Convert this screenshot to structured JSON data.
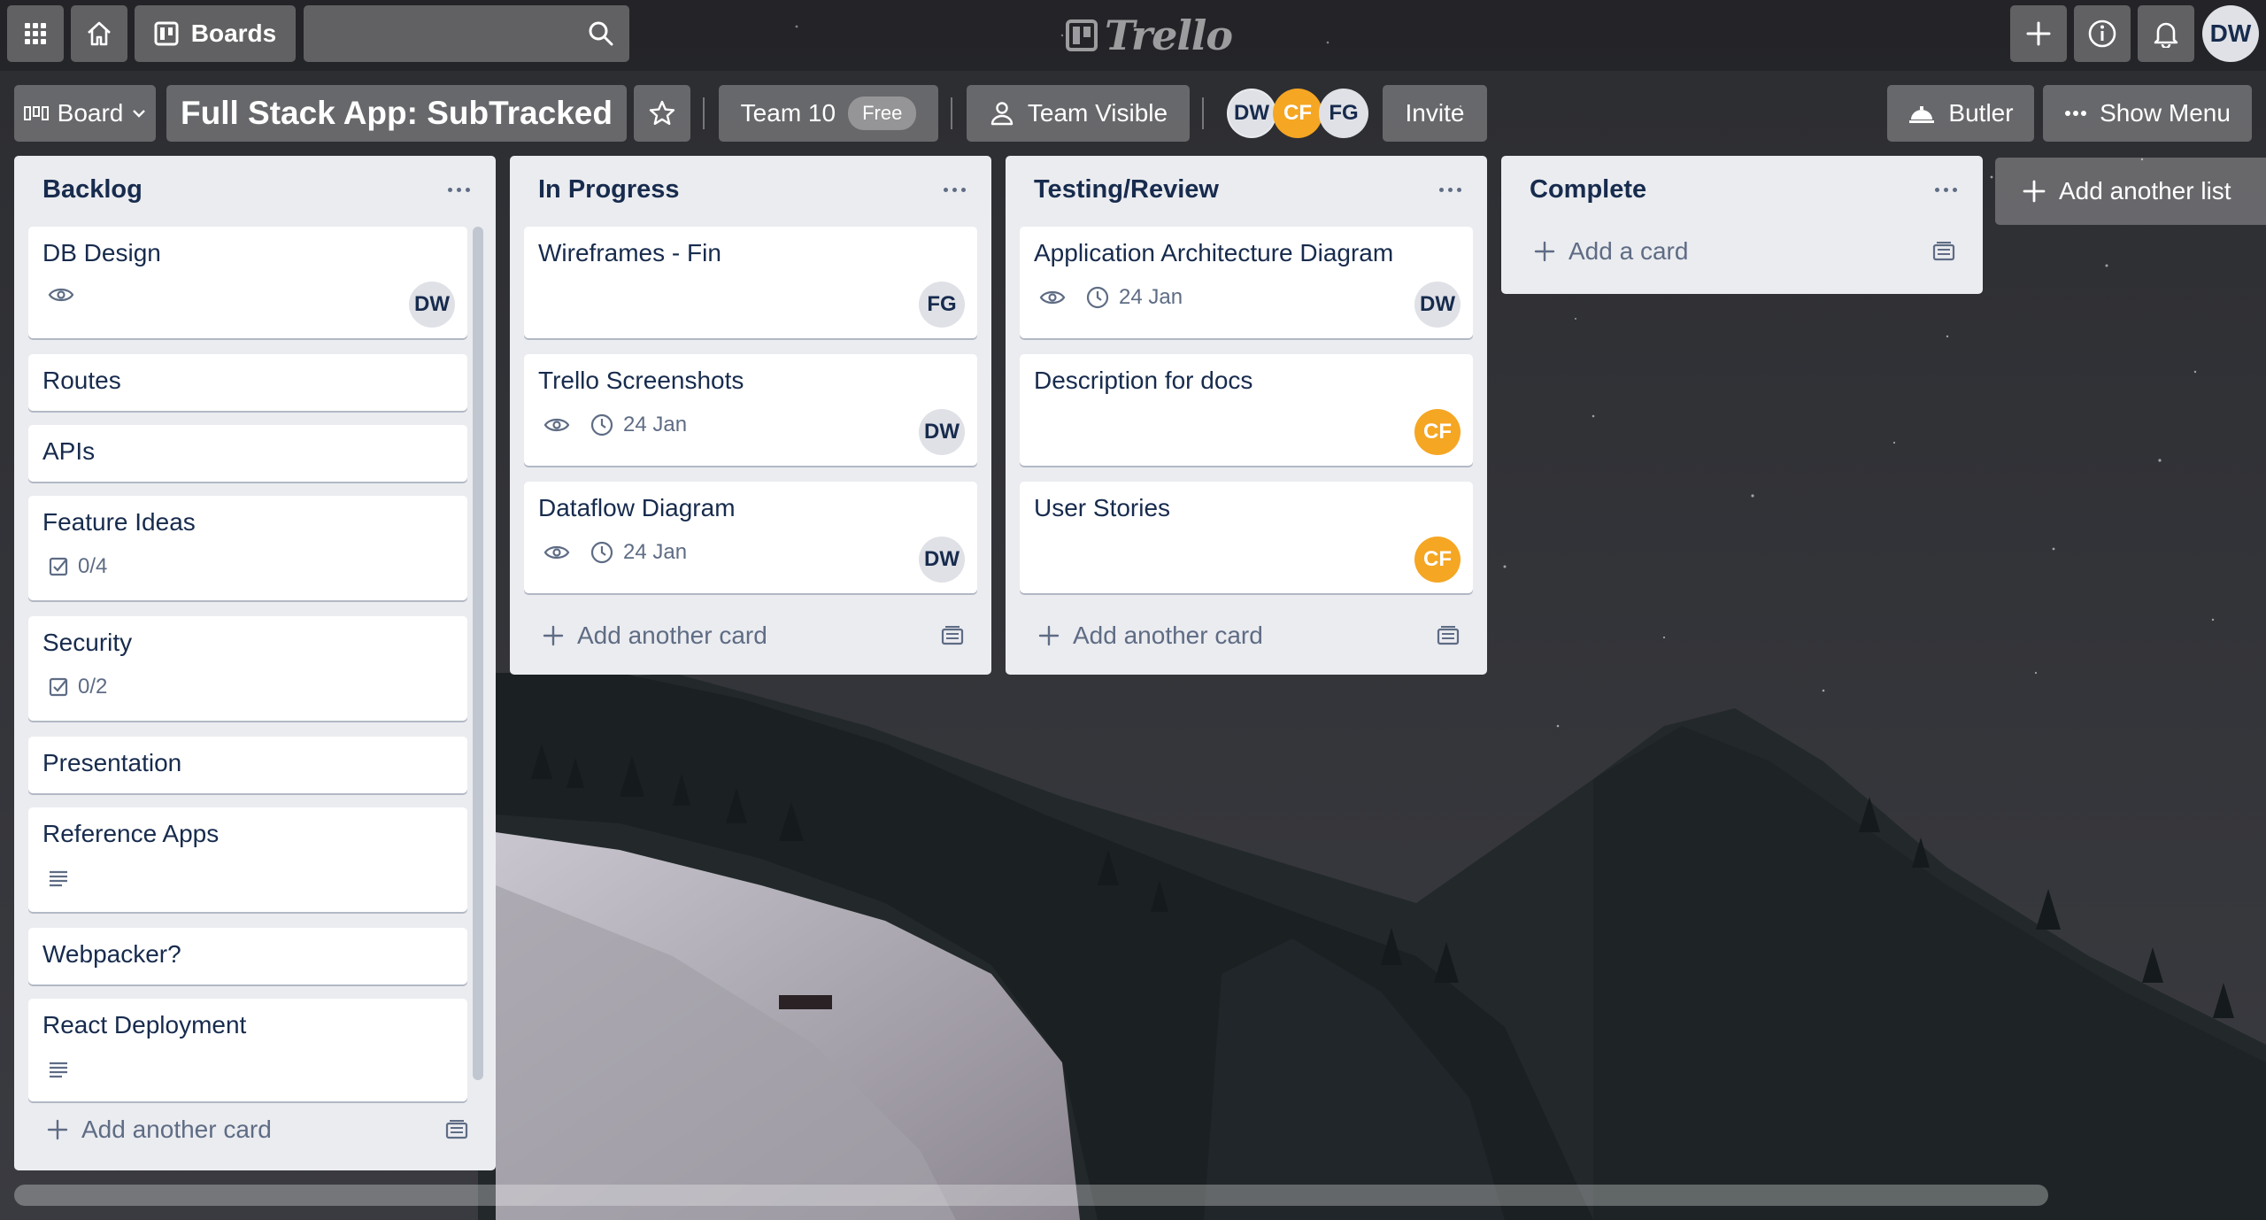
{
  "header": {
    "boards_label": "Boards",
    "search_placeholder": "",
    "logo_text": "Trello",
    "user_initials": "DW"
  },
  "board": {
    "view_label": "Board",
    "title": "Full Stack App: SubTracked",
    "team_label": "Team 10",
    "team_badge": "Free",
    "visibility_label": "Team Visible",
    "members": [
      {
        "initials": "DW",
        "color": "#dfe1e6"
      },
      {
        "initials": "CF",
        "color": "#f5a623"
      },
      {
        "initials": "FG",
        "color": "#dfe1e6"
      }
    ],
    "invite_label": "Invite",
    "butler_label": "Butler",
    "show_menu_label": "Show Menu"
  },
  "lists": [
    {
      "title": "Backlog",
      "add_label": "Add another card",
      "cards": [
        {
          "title": "DB Design",
          "watch": true,
          "member": "DW"
        },
        {
          "title": "Routes"
        },
        {
          "title": "APIs"
        },
        {
          "title": "Feature Ideas",
          "checklist": "0/4"
        },
        {
          "title": "Security",
          "checklist": "0/2"
        },
        {
          "title": "Presentation"
        },
        {
          "title": "Reference Apps",
          "description": true
        },
        {
          "title": "Webpacker?"
        },
        {
          "title": "React Deployment",
          "description": true
        }
      ]
    },
    {
      "title": "In Progress",
      "add_label": "Add another card",
      "cards": [
        {
          "title": "Wireframes - Fin",
          "member": "FG"
        },
        {
          "title": "Trello Screenshots",
          "watch": true,
          "due": "24 Jan",
          "member": "DW"
        },
        {
          "title": "Dataflow Diagram",
          "watch": true,
          "due": "24 Jan",
          "member": "DW"
        }
      ]
    },
    {
      "title": "Testing/Review",
      "add_label": "Add another card",
      "cards": [
        {
          "title": "Application Architecture Diagram",
          "watch": true,
          "due": "24 Jan",
          "member": "DW"
        },
        {
          "title": "Description for docs",
          "member": "CF"
        },
        {
          "title": "User Stories",
          "member": "CF"
        }
      ]
    },
    {
      "title": "Complete",
      "add_label": "Add a card",
      "cards": []
    }
  ],
  "add_list_label": "Add another list"
}
